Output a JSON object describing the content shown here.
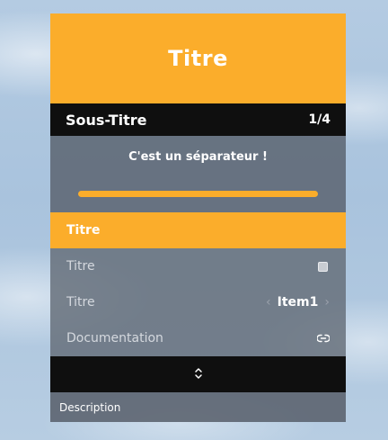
{
  "header": {
    "title": "Titre"
  },
  "subheader": {
    "title": "Sous-Titre",
    "count": "1/4"
  },
  "separator": {
    "text": "C'est un séparateur !"
  },
  "items": [
    {
      "label": "Titre"
    },
    {
      "label": "Titre",
      "checked": false
    },
    {
      "label": "Titre",
      "value": "Item1"
    },
    {
      "label": "Documentation"
    }
  ],
  "footer": {
    "icon": "chevron-up-down-icon"
  },
  "description": {
    "text": "Description"
  },
  "colors": {
    "accent": "#fbad2b",
    "dark": "#0f0f0f"
  }
}
